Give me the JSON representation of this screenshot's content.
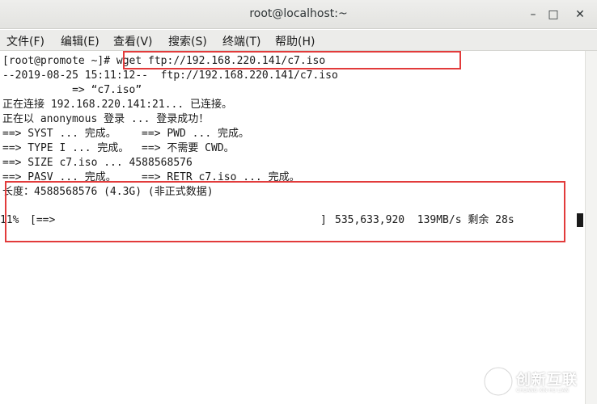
{
  "window": {
    "title": "root@localhost:~",
    "minimize_glyph": "–",
    "maximize_glyph": "□",
    "close_glyph": "✕"
  },
  "menu": [
    "文件(F)",
    "编辑(E)",
    "查看(V)",
    "搜索(S)",
    "终端(T)",
    "帮助(H)"
  ],
  "terminal": {
    "prompt": "[root@promote ~]# ",
    "command": "wget ftp://192.168.220.141/c7.iso",
    "lines": [
      "--2019-08-25 15:11:12--  ftp://192.168.220.141/c7.iso",
      "           => “c7.iso”",
      "正在连接 192.168.220.141:21... 已连接。",
      "正在以 anonymous 登录 ... 登录成功！",
      "==> SYST ... 完成。    ==> PWD ... 完成。",
      "==> TYPE I ... 完成。  ==> 不需要 CWD。",
      "==> SIZE c7.iso ... 4588568576",
      "==> PASV ... 完成。    ==> RETR c7.iso ... 完成。",
      "长度：4588568576 (4.3G) (非正式数据)"
    ],
    "progress": {
      "percent": "11%",
      "bar": "[==>",
      "bar_end": "]",
      "stats": "535,633,920  139MB/s 剩余 28s"
    }
  },
  "annotations": {
    "color": "#e23b3b"
  },
  "watermark": {
    "text": "创新互联",
    "subtext": "CHUANG XIN HU LIAN"
  }
}
